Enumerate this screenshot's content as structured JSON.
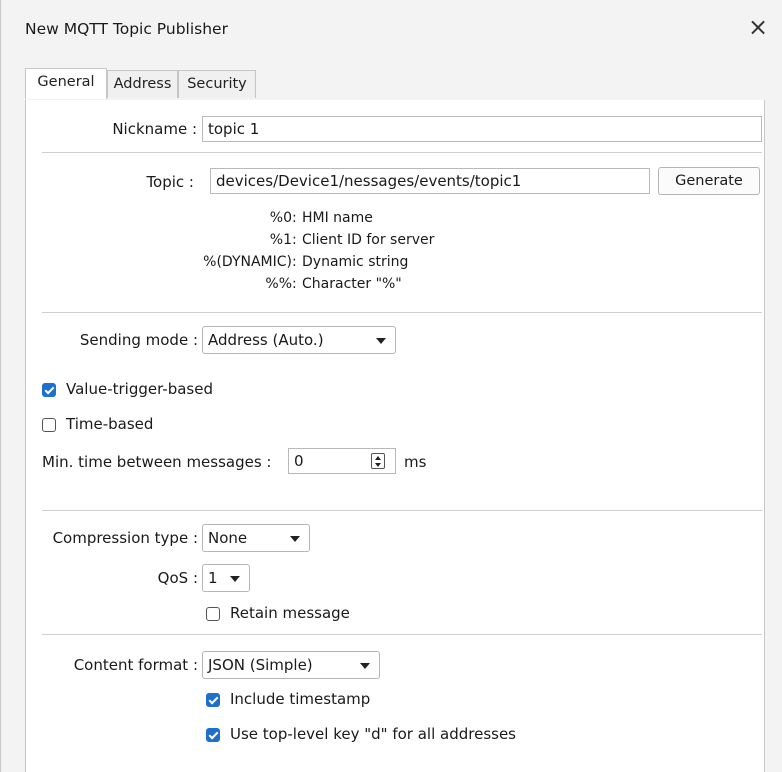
{
  "window": {
    "title": "New MQTT Topic Publisher",
    "close_glyph": "×"
  },
  "tabs": [
    {
      "label": "General",
      "active": true
    },
    {
      "label": "Address",
      "active": false
    },
    {
      "label": "Security",
      "active": false
    }
  ],
  "general": {
    "nickname_label": "Nickname :",
    "nickname_value": "topic 1",
    "topic_label": "Topic :",
    "topic_value": "devices/Device1/nessages/events/topic1",
    "generate_label": "Generate",
    "legend": [
      {
        "code": "%0",
        "desc": "HMI name"
      },
      {
        "code": "%1",
        "desc": "Client ID for server"
      },
      {
        "code": "%(DYNAMIC)",
        "desc": "Dynamic string"
      },
      {
        "code": "%%",
        "desc": "Character \"%\""
      }
    ],
    "sending_mode_label": "Sending mode :",
    "sending_mode_value": "Address (Auto.)",
    "value_trigger_label": "Value-trigger-based",
    "value_trigger_checked": true,
    "time_based_label": "Time-based",
    "time_based_checked": false,
    "min_time_label": "Min. time between messages :",
    "min_time_value": "0",
    "min_time_unit": "ms",
    "compression_label": "Compression type :",
    "compression_value": "None",
    "qos_label": "QoS :",
    "qos_value": "1",
    "retain_label": "Retain message",
    "retain_checked": false,
    "content_format_label": "Content format :",
    "content_format_value": "JSON (Simple)",
    "include_timestamp_label": "Include timestamp",
    "include_timestamp_checked": true,
    "top_level_key_label": "Use top-level key \"d\" for all addresses",
    "top_level_key_checked": true
  },
  "colors": {
    "accent": "#1f6fd1",
    "dialog_bg": "#f3f3f3",
    "panel_bg": "#ffffff",
    "border": "#c6c6c6"
  },
  "icons": {
    "close": "close-icon",
    "dropdown": "chevron-down-icon",
    "spinner": "spinner-icon",
    "check": "check-icon"
  }
}
